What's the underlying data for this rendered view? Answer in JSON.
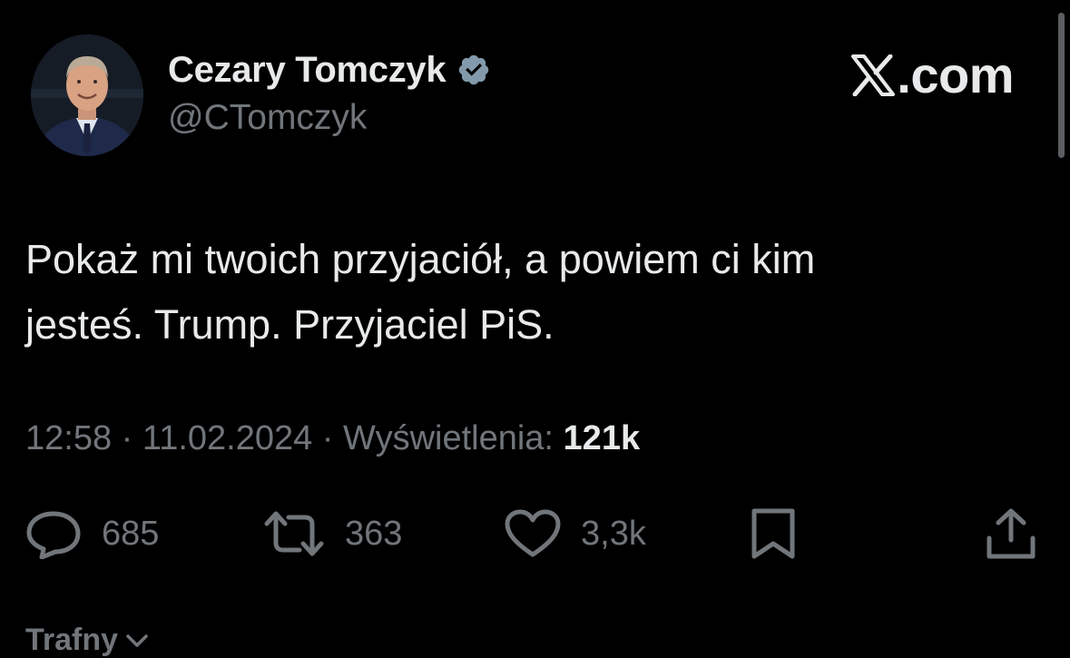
{
  "author": {
    "name": "Cezary Tomczyk",
    "handle": "@CTomczyk",
    "verified_icon": "verified-badge-icon",
    "avatar_icon": "profile-photo"
  },
  "brand": {
    "text": ".com",
    "icon": "x-logo-icon"
  },
  "tweet": {
    "text": "Pokaż mi twoich przyjaciół, a powiem ci kim\njesteś. Trump. Przyjaciel PiS."
  },
  "meta": {
    "time": "12:58",
    "separator": " · ",
    "date": "11.02.2024",
    "views_label": "Wyświetlenia: ",
    "views_count": "121k"
  },
  "actions": {
    "replies": "685",
    "retweets": "363",
    "likes": "3,3k"
  },
  "sort": {
    "label": "Trafny"
  },
  "colors": {
    "background": "#000000",
    "text": "#e7e9ea",
    "muted": "#71767b",
    "verified_badge": "#829aab"
  }
}
